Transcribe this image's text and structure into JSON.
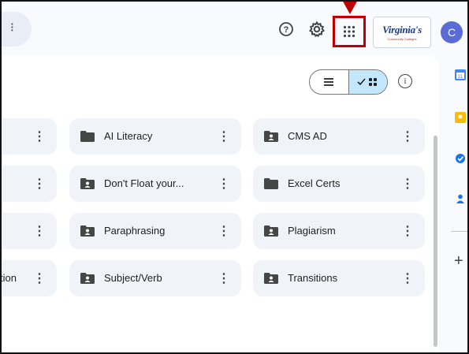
{
  "header": {
    "help_icon": "help-circle-icon",
    "settings_icon": "gear-icon",
    "apps_icon": "apps-grid-icon",
    "logo_text": "Virginia's",
    "logo_subtext": "Community Colleges",
    "avatar_initial": "C",
    "highlight_color": "#c00000"
  },
  "toolbar": {
    "list_view_icon": "list-view-icon",
    "grid_view_icon": "grid-view-icon",
    "active_view": "grid",
    "info_icon": "info-icon"
  },
  "folders": [
    [
      {
        "name": "",
        "shared": false
      },
      {
        "name": "AI Literacy",
        "shared": false
      },
      {
        "name": "CMS AD",
        "shared": true
      }
    ],
    [
      {
        "name": "",
        "shared": false
      },
      {
        "name": "Don't Float your...",
        "shared": true
      },
      {
        "name": "Excel Certs",
        "shared": false
      }
    ],
    [
      {
        "name": "",
        "shared": false
      },
      {
        "name": "Paraphrasing",
        "shared": true
      },
      {
        "name": "Plagiarism",
        "shared": true
      }
    ],
    [
      {
        "name": "tion",
        "shared": false
      },
      {
        "name": "Subject/Verb",
        "shared": true
      },
      {
        "name": "Transitions",
        "shared": true
      }
    ]
  ],
  "side_panel": {
    "items": [
      "calendar-icon",
      "keep-icon",
      "tasks-icon",
      "contacts-icon"
    ],
    "add_label": "+"
  },
  "colors": {
    "accent": "#c2e7ff",
    "tile_bg": "#f0f4f9",
    "avatar_bg": "#5b6bd6"
  }
}
